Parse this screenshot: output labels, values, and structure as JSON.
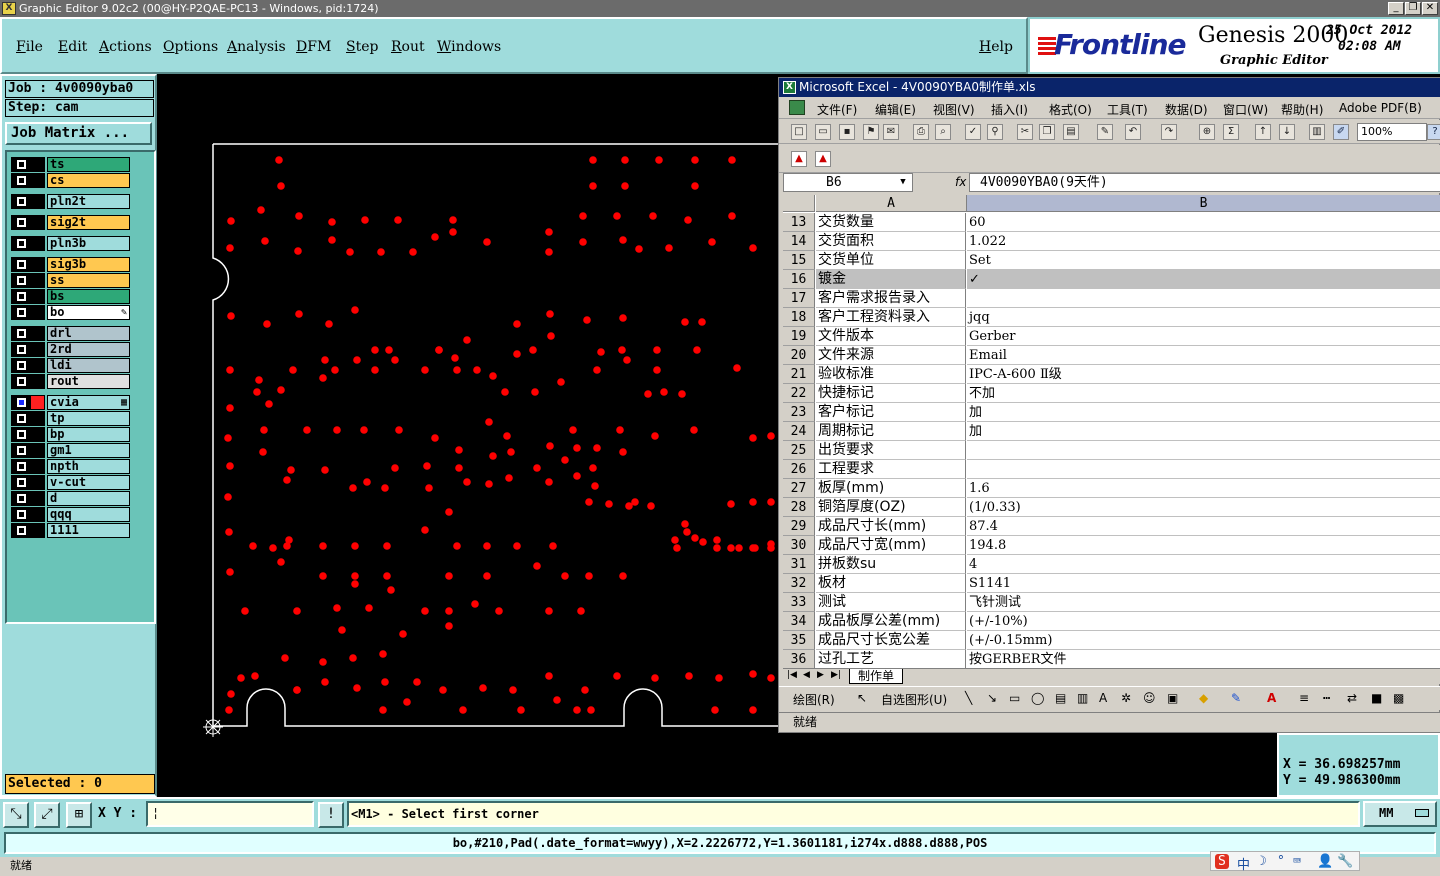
{
  "window": {
    "title": "Graphic Editor 9.02c2 (00@HY-P2QAE-PC13 - Windows, pid:1724)",
    "buttons": [
      "_",
      "❐",
      "✕"
    ]
  },
  "menu": {
    "items": [
      "File",
      "Edit",
      "Actions",
      "Options",
      "Analysis",
      "DFM",
      "Step",
      "Rout",
      "Windows"
    ],
    "help": "Help"
  },
  "branding": {
    "brand": "Frontline",
    "product": "Genesis 2000",
    "subtitle": "Graphic Editor",
    "date": "25 Oct 2012",
    "time": "02:08 AM",
    "accent": "#e01010",
    "brand_color": "#1a2a9a"
  },
  "job": {
    "job_label": "Job : 4v0090yba0",
    "step_label": "Step: cam",
    "job_matrix": "Job Matrix ...",
    "selected": "Selected : 0"
  },
  "layers": [
    {
      "name": "ts",
      "color": "#2ea878",
      "mark": ""
    },
    {
      "name": "cs",
      "color": "#ffc850",
      "mark": ""
    },
    {
      "name": "pln2t",
      "color": "#9fdcdc",
      "mark": ""
    },
    {
      "name": "sig2t",
      "color": "#ffc850",
      "mark": ""
    },
    {
      "name": "pln3b",
      "color": "#9fdcdc",
      "mark": ""
    },
    {
      "name": "sig3b",
      "color": "#ffc850",
      "mark": ""
    },
    {
      "name": "ss",
      "color": "#ffc850",
      "mark": ""
    },
    {
      "name": "bs",
      "color": "#2ea878",
      "mark": ""
    },
    {
      "name": "bo",
      "color": "#ffffff",
      "mark": "✎"
    },
    {
      "name": "drl",
      "color": "#b0c4cc",
      "mark": ""
    },
    {
      "name": "2rd",
      "color": "#b0c4cc",
      "mark": ""
    },
    {
      "name": "ldi",
      "color": "#b0c4cc",
      "mark": ""
    },
    {
      "name": "rout",
      "color": "#e0e0e0",
      "mark": ""
    },
    {
      "name": "cvia",
      "color": "#9fdcdc",
      "mark": "▦"
    },
    {
      "name": "tp",
      "color": "#9fdcdc",
      "mark": ""
    },
    {
      "name": "bp",
      "color": "#9fdcdc",
      "mark": ""
    },
    {
      "name": "gm1",
      "color": "#9fdcdc",
      "mark": ""
    },
    {
      "name": "npth",
      "color": "#9fdcdc",
      "mark": ""
    },
    {
      "name": "v-cut",
      "color": "#9fdcdc",
      "mark": ""
    },
    {
      "name": "d",
      "color": "#9fdcdc",
      "mark": ""
    },
    {
      "name": "qqq",
      "color": "#9fdcdc",
      "mark": ""
    },
    {
      "name": "1111",
      "color": "#9fdcdc",
      "mark": ""
    }
  ],
  "canvas": {
    "pad_color": "#ff0000",
    "outline_color": "#ffffff"
  },
  "coords": {
    "x": "X  = 36.698257mm",
    "y": "Y  = 49.986300mm"
  },
  "excel": {
    "title": "Microsoft Excel - 4V0090YBA0制作单.xls",
    "menu": [
      "文件(F)",
      "编辑(E)",
      "视图(V)",
      "插入(I)",
      "格式(O)",
      "工具(T)",
      "数据(D)",
      "窗口(W)",
      "帮助(H)",
      "Adobe PDF(B)"
    ],
    "zoom": "100%",
    "name_box": "B6",
    "fx": "fx",
    "formula": "4V0090YBA0(9天件)",
    "columns": [
      "A",
      "B"
    ],
    "rows": [
      {
        "num": "13",
        "a": "交货数量",
        "b": "60"
      },
      {
        "num": "14",
        "a": "交货面积",
        "b": "1.022"
      },
      {
        "num": "15",
        "a": "交货单位",
        "b": "Set"
      },
      {
        "num": "16",
        "a": "镀金",
        "b": "✓"
      },
      {
        "num": "17",
        "a": "客户需求报告录入",
        "b": ""
      },
      {
        "num": "18",
        "a": "客户工程资料录入",
        "b": "jqq"
      },
      {
        "num": "19",
        "a": "文件版本",
        "b": "Gerber"
      },
      {
        "num": "20",
        "a": "文件来源",
        "b": "Email"
      },
      {
        "num": "21",
        "a": "验收标准",
        "b": "IPC-A-600 Ⅱ级"
      },
      {
        "num": "22",
        "a": "快捷标记",
        "b": "不加"
      },
      {
        "num": "23",
        "a": "客户标记",
        "b": "加"
      },
      {
        "num": "24",
        "a": "周期标记",
        "b": "加"
      },
      {
        "num": "25",
        "a": "出货要求",
        "b": ""
      },
      {
        "num": "26",
        "a": "工程要求",
        "b": ""
      },
      {
        "num": "27",
        "a": "板厚(mm)",
        "b": "1.6"
      },
      {
        "num": "28",
        "a": "铜箔厚度(OZ)",
        "b": "(1/0.33)"
      },
      {
        "num": "29",
        "a": "成品尺寸长(mm)",
        "b": "87.4"
      },
      {
        "num": "30",
        "a": "成品尺寸宽(mm)",
        "b": "194.8"
      },
      {
        "num": "31",
        "a": "拼板数su",
        "b": "4"
      },
      {
        "num": "32",
        "a": "板材",
        "b": "S1141"
      },
      {
        "num": "33",
        "a": "测试",
        "b": "飞针测试"
      },
      {
        "num": "34",
        "a": "成品板厚公差(mm)",
        "b": "(+/-10%)"
      },
      {
        "num": "35",
        "a": "成品尺寸长宽公差",
        "b": "(+/-0.15mm)"
      },
      {
        "num": "36",
        "a": "过孔工艺",
        "b": "按GERBER文件"
      }
    ],
    "sheet_tab": "制作单",
    "draw_label": "绘图(R)",
    "autoshape_label": "自选图形(U)",
    "status": "就绪"
  },
  "command": {
    "xy_label": "X Y :",
    "xy_value": "¦",
    "prompt": "<M1> - Select first corner",
    "units": "MM",
    "info": "bo,#210,Pad(.date_format=wwyy),X=2.2226772,Y=1.3601181,i274x.d888.d888,POS",
    "status": "就绪"
  },
  "ime": [
    "S",
    "中",
    "☽",
    "°",
    "⌨",
    "👤",
    "🔧"
  ]
}
